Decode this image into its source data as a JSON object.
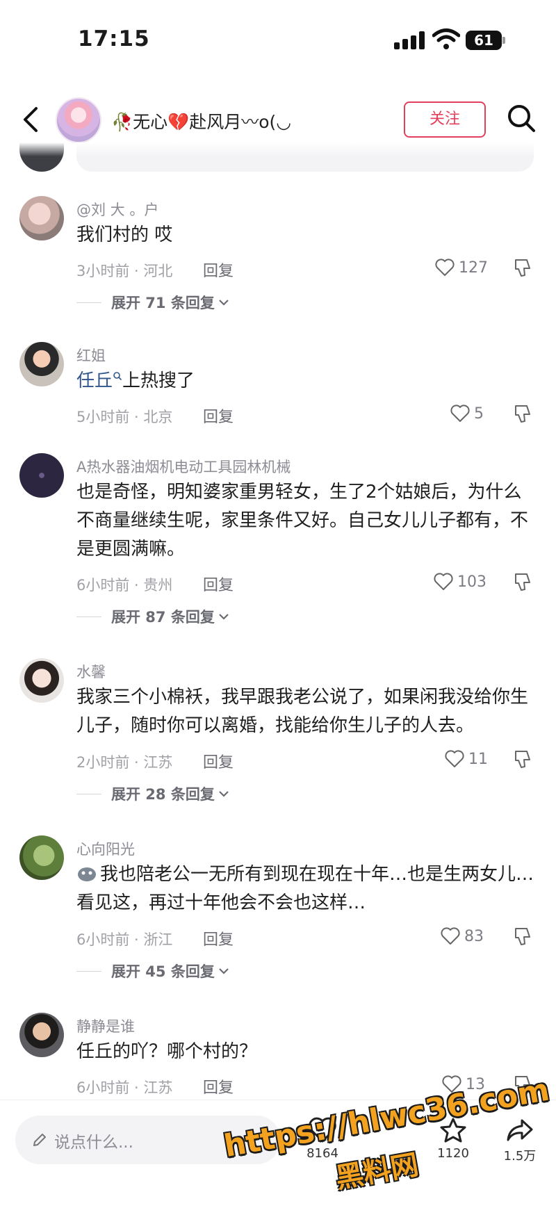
{
  "status_bar": {
    "time": "17:15",
    "battery": "61"
  },
  "header": {
    "profile_name": "🥀无心💔赴风月〰o(◡",
    "follow_label": "关注"
  },
  "comments": [
    {
      "username": "@刘 大 。户",
      "text": "我们村的 哎",
      "time_location": "3小时前 · 河北",
      "reply_label": "回复",
      "likes": "127",
      "expand": "展开 71 条回复"
    },
    {
      "username": "红姐",
      "hashtag": "任丘",
      "text": "上热搜了",
      "time_location": "5小时前 · 北京",
      "reply_label": "回复",
      "likes": "5"
    },
    {
      "username": "A热水器油烟机电动工具园林机械",
      "text": "也是奇怪，明知婆家重男轻女，生了2个姑娘后，为什么不商量继续生呢，家里条件又好。自己女儿儿子都有，不是更圆满嘛。",
      "time_location": "6小时前 · 贵州",
      "reply_label": "回复",
      "likes": "103",
      "expand": "展开 87 条回复"
    },
    {
      "username": "水馨",
      "text": "我家三个小棉袄，我早跟我老公说了，如果闲我没给你生儿子，随时你可以离婚，找能给你生儿子的人去。",
      "time_location": "2小时前 · 江苏",
      "reply_label": "回复",
      "likes": "11",
      "expand": "展开 28 条回复"
    },
    {
      "username": "心向阳光",
      "text": "我也陪老公一无所有到现在现在十年…也是生两女儿…看见这，再过十年他会不会也这样…",
      "time_location": "6小时前 · 浙江",
      "reply_label": "回复",
      "likes": "83",
      "expand": "展开 45 条回复"
    },
    {
      "username": "静静是谁",
      "text": "任丘的吖？哪个村的？",
      "time_location": "6小时前 · 江苏",
      "reply_label": "回复",
      "likes": "13"
    }
  ],
  "bottom_bar": {
    "input_placeholder": "说点什么...",
    "like_count": "8164",
    "collect_count": "1120",
    "share_count": "1.5万"
  },
  "watermark": {
    "url": "https://hlwc36.com",
    "name": "黑料网"
  },
  "colors": {
    "accent": "#e43f5a",
    "hashtag": "#30568c",
    "watermark": "#f3a21f"
  }
}
